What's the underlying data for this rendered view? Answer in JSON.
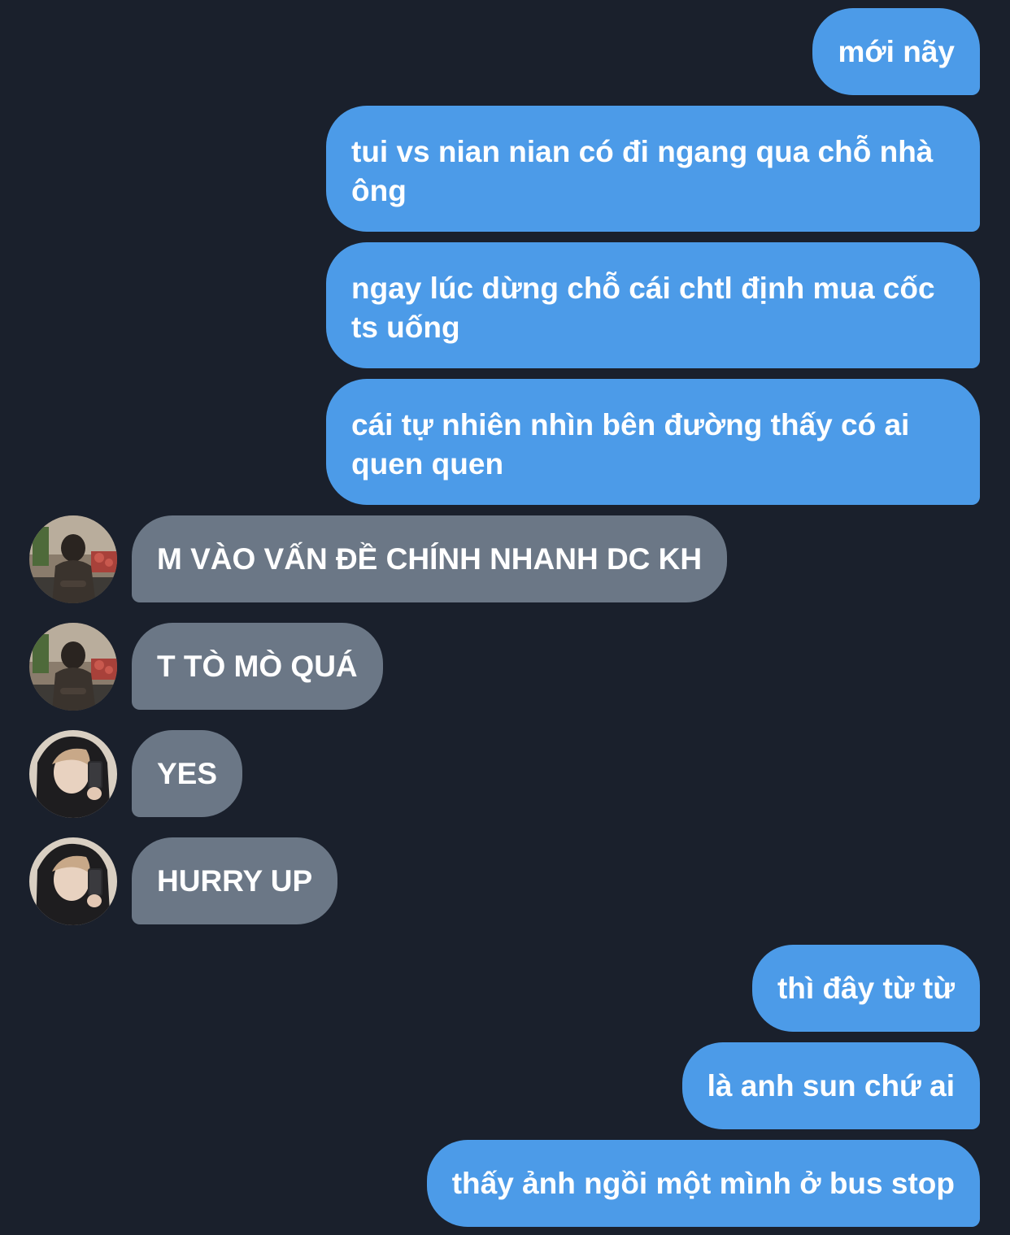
{
  "colors": {
    "background": "#1a202c",
    "sent_bubble": "#4c9be8",
    "received_bubble": "#6b7786",
    "text": "#ffffff"
  },
  "messages": [
    {
      "direction": "sent",
      "text": "mới nãy"
    },
    {
      "direction": "sent",
      "text": "tui vs nian nian có đi ngang qua chỗ nhà ông"
    },
    {
      "direction": "sent",
      "text": "ngay lúc dừng chỗ cái chtl định mua cốc ts uống"
    },
    {
      "direction": "sent",
      "text": "cái tự nhiên nhìn bên đường thấy có ai quen quen"
    },
    {
      "direction": "received",
      "text": "M VÀO VẤN ĐỀ CHÍNH NHANH DC KH",
      "avatar": "avatar-photo-hooded-person-sitting"
    },
    {
      "direction": "received",
      "text": "T TÒ MÒ QUÁ",
      "avatar": "avatar-photo-hooded-person-sitting"
    },
    {
      "direction": "received",
      "text": "YES",
      "avatar": "avatar-photo-mirror-selfie"
    },
    {
      "direction": "received",
      "text": "HURRY UP",
      "avatar": "avatar-photo-mirror-selfie"
    },
    {
      "direction": "sent",
      "text": "thì đây từ từ"
    },
    {
      "direction": "sent",
      "text": "là anh sun chứ ai"
    },
    {
      "direction": "sent",
      "text": "thấy ảnh ngồi một mình ở bus stop"
    }
  ]
}
